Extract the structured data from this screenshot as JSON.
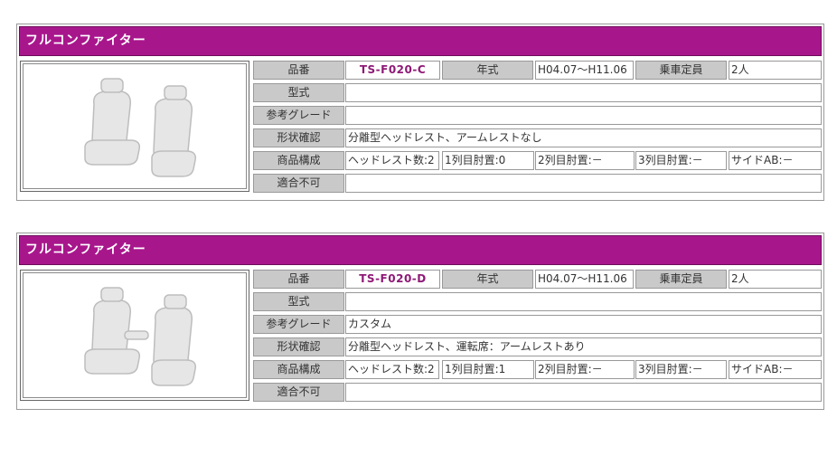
{
  "labels": {
    "part_number": "品番",
    "year": "年式",
    "capacity": "乗車定員",
    "model_type": "型式",
    "grade": "参考グレード",
    "shape": "形状確認",
    "composition": "商品構成",
    "compatibility": "適合不可"
  },
  "products": [
    {
      "title": "フルコンファイター",
      "part_number": "TS-F020-C",
      "year": "H04.07～H11.06",
      "capacity": "2人",
      "model_type": "",
      "grade": "",
      "shape": "分離型ヘッドレスト、アームレストなし",
      "composition": [
        "ヘッドレスト数:2",
        "1列目肘置:0",
        "2列目肘置:－",
        "3列目肘置:－",
        "サイドAB:－"
      ],
      "compatibility": "",
      "image_icon": "seat-pair-icon"
    },
    {
      "title": "フルコンファイター",
      "part_number": "TS-F020-D",
      "year": "H04.07～H11.06",
      "capacity": "2人",
      "model_type": "",
      "grade": "カスタム",
      "shape": "分離型ヘッドレスト、運転席：アームレストあり",
      "composition": [
        "ヘッドレスト数:2",
        "1列目肘置:1",
        "2列目肘置:－",
        "3列目肘置:－",
        "サイドAB:－"
      ],
      "compatibility": "",
      "image_icon": "seat-pair-armrest-icon"
    }
  ],
  "colors": {
    "title_bar": "#a8168c",
    "label_bg": "#c9c9c9",
    "part_number_text": "#8e1976"
  }
}
